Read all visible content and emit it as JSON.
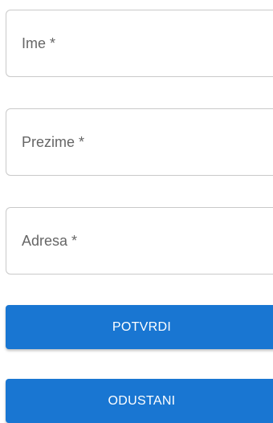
{
  "form": {
    "fields": [
      {
        "label": "Ime *",
        "value": ""
      },
      {
        "label": "Prezime *",
        "value": ""
      },
      {
        "label": "Adresa *",
        "value": ""
      }
    ],
    "buttons": {
      "confirm_label": "POTVRDI",
      "cancel_label": "ODUSTANI"
    },
    "colors": {
      "primary": "#1976d2",
      "border": "#c9c9c9",
      "label_text": "#666666"
    }
  }
}
